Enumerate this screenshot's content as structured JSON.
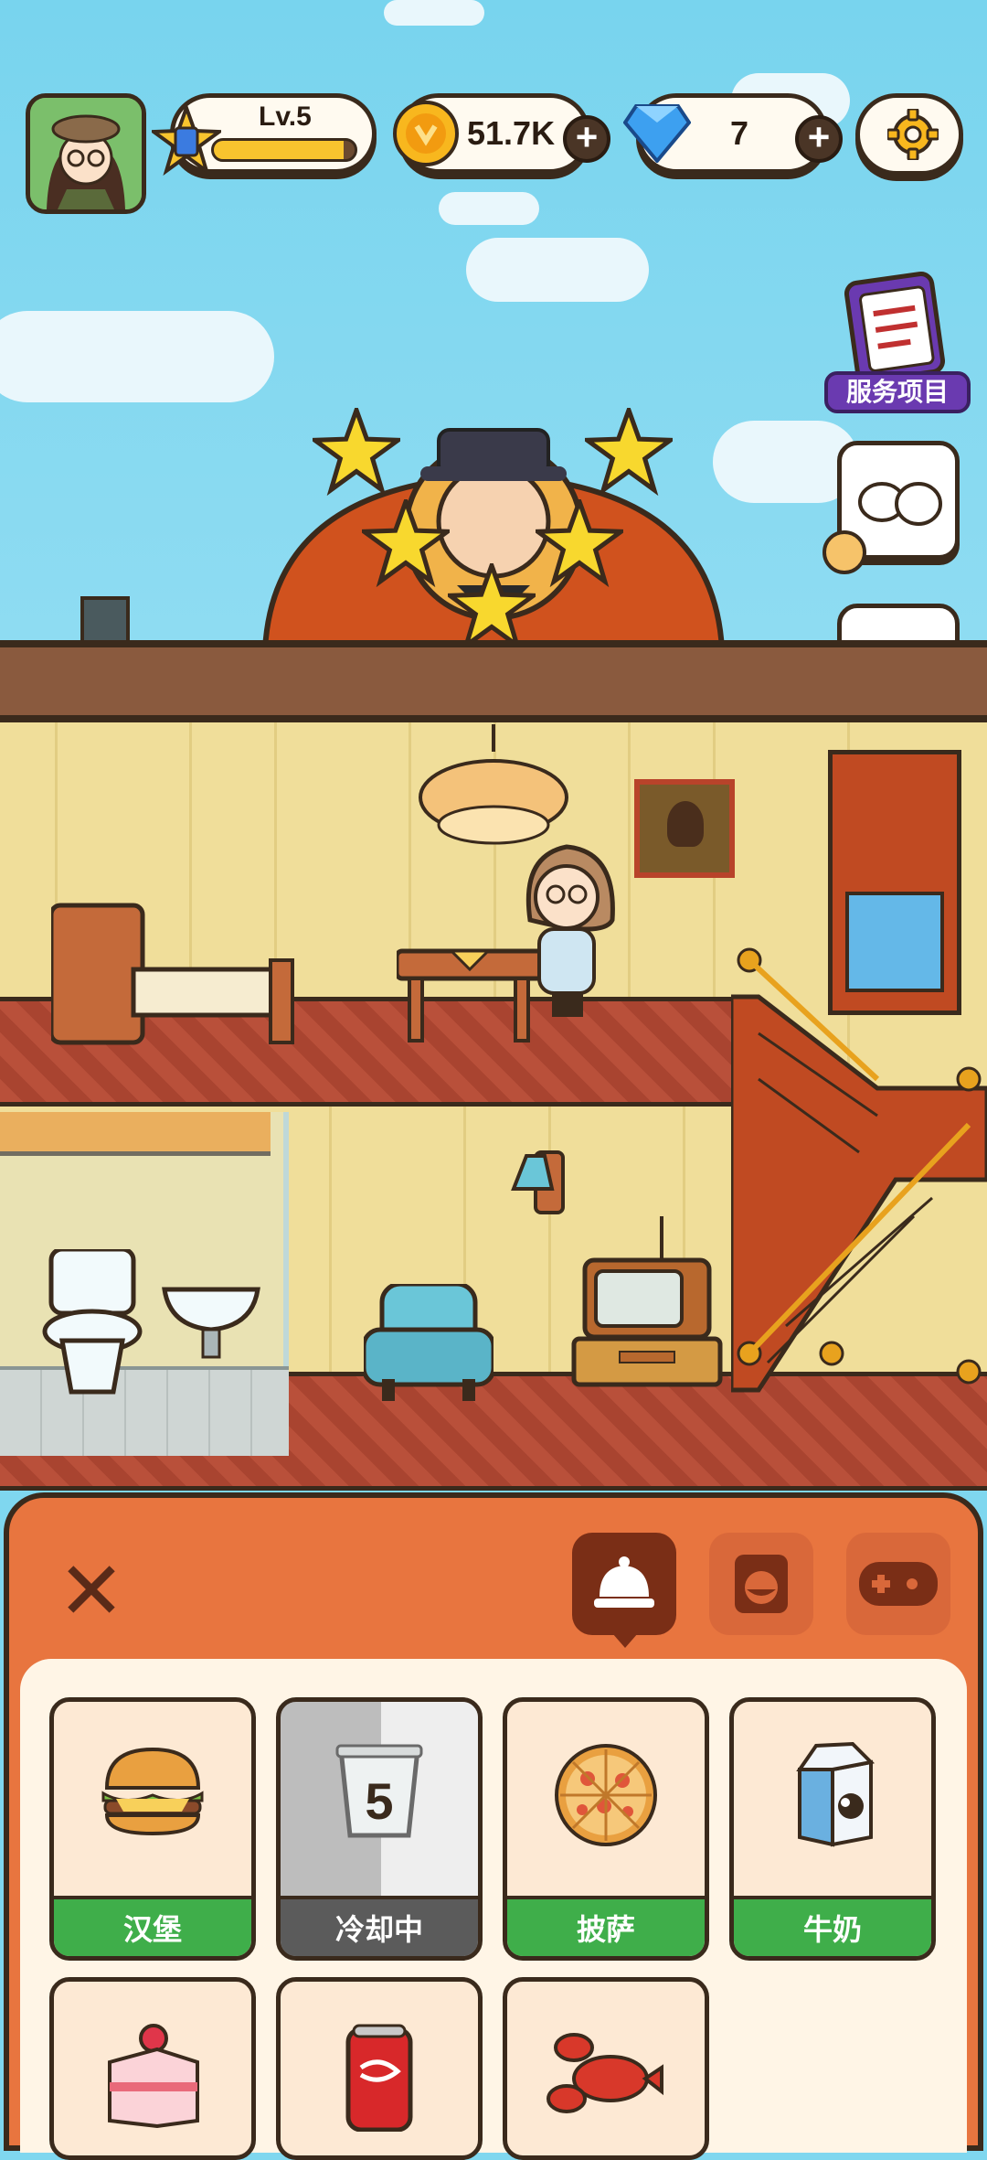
{
  "hud": {
    "level_label": "Lv.5",
    "level_progress": 0.92,
    "coins": "51.7K",
    "gems": "7",
    "add_symbol": "+"
  },
  "side": {
    "service_label": "服务项目",
    "requests": [
      {
        "icon": "strength-fists-icon"
      },
      {
        "icon": "strength-fists-icon"
      },
      {
        "icon": "flexed-arm-icon"
      }
    ]
  },
  "panel": {
    "close_symbol": "✕",
    "tabs": [
      {
        "name": "food-tab",
        "icon": "service-bell-icon",
        "active": true
      },
      {
        "name": "laundry-tab",
        "icon": "washing-machine-icon",
        "active": false
      },
      {
        "name": "games-tab",
        "icon": "gamepad-icon",
        "active": false
      }
    ],
    "items": [
      {
        "icon": "burger-icon",
        "label": "汉堡",
        "state": "ready"
      },
      {
        "icon": "cup-icon",
        "label": "冷却中",
        "state": "cooldown",
        "cooldown": "5"
      },
      {
        "icon": "pizza-icon",
        "label": "披萨",
        "state": "ready"
      },
      {
        "icon": "milk-carton-icon",
        "label": "牛奶",
        "state": "ready"
      },
      {
        "icon": "cake-icon",
        "label": "",
        "state": "ready"
      },
      {
        "icon": "cola-can-icon",
        "label": "",
        "state": "ready"
      },
      {
        "icon": "lobster-icon",
        "label": "",
        "state": "ready"
      }
    ]
  },
  "colors": {
    "accent_orange": "#e8753f",
    "ready_green": "#3fae4a",
    "cooldown_gray": "#5b5b5b",
    "outline": "#3a2a1c"
  }
}
